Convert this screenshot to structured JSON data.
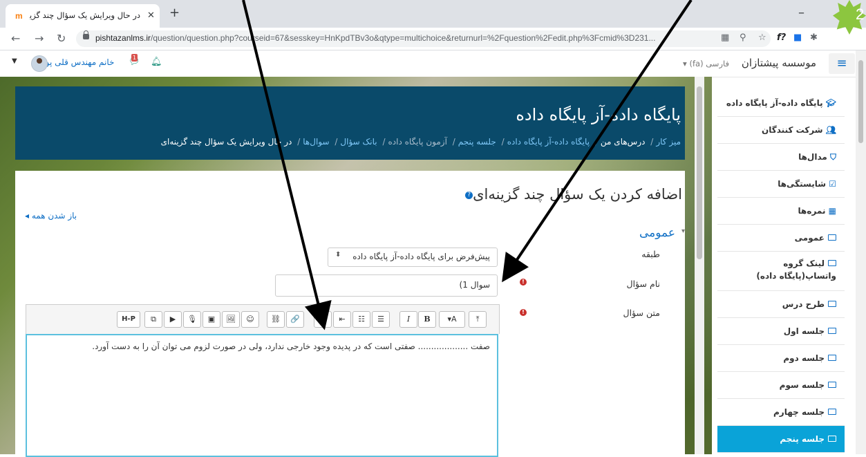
{
  "browser": {
    "tab_title": "در حال ویرایش یک سؤال چند گزینه‌ای",
    "tab_favicon": "m",
    "url_host": "pishtazanlms.ir",
    "url_path": "/question/question.php?courseid=67&sesskey=HnKpdTBv3o&qtype=multichoice&returnurl=%2Fquestion%2Fedit.php%3Fcmid%3D231..."
  },
  "navbar": {
    "brand": "موسسه پیشتازان",
    "language": "فارسی ‎(fa)‎",
    "user_name": "خانم مهندس قلی پور",
    "notification_count": "1"
  },
  "header": {
    "course_title": "پایگاه داده-آز پایگاه داده",
    "breadcrumbs": [
      "میز کار",
      "درس‌های من",
      "پایگاه داده-آز پایگاه داده",
      "جلسه پنجم",
      "آزمون پایگاه داده",
      "بانک سؤال",
      "سوال‌ها",
      "در حال ویرایش یک سؤال چند گزینه‌ای"
    ]
  },
  "form": {
    "heading": "اضافه کردن یک سؤال چند گزینه‌ای",
    "expand_all": "باز شدن همه",
    "section": "عمومی",
    "category_label": "طبقه",
    "category_value": "پیش‌فرض برای پایگاه داده-آز پایگاه داده",
    "name_label": "نام سؤال",
    "name_value": "سوال 1)",
    "text_label": "متن سؤال",
    "text_value": "صفت ................... صفتی است که در پدیده وجود خارجی ندارد، ولی در صورت لزوم می توان آن را به دست آورد."
  },
  "editor_toolbar": [
    "⤒",
    "▾A",
    "B",
    "I",
    "☰",
    "☷",
    "⇤",
    "⇥",
    "🔗",
    "⛓",
    "☺",
    "🖼",
    "▣",
    "🎙",
    "▶",
    "⧉",
    "H-P"
  ],
  "sidebar": {
    "items": [
      {
        "label": "پایگاه داده-آز پایگاه داده",
        "icon": "graduation-cap-icon"
      },
      {
        "label": "شرکت کنندگان",
        "icon": "users-icon"
      },
      {
        "label": "مدال‌ها",
        "icon": "shield-icon"
      },
      {
        "label": "شایستگی‌ها",
        "icon": "check-square-icon"
      },
      {
        "label": "نمره‌ها",
        "icon": "table-icon"
      },
      {
        "label": "عمومی",
        "icon": "folder-icon"
      },
      {
        "label": "لینک گروه واتساپ(پایگاه داده)",
        "icon": "folder-icon"
      },
      {
        "label": "طرح درس",
        "icon": "folder-icon"
      },
      {
        "label": "جلسه اول",
        "icon": "folder-icon"
      },
      {
        "label": "جلسه دوم",
        "icon": "folder-icon"
      },
      {
        "label": "جلسه سوم",
        "icon": "folder-icon"
      },
      {
        "label": "جلسه چهارم",
        "icon": "folder-icon"
      },
      {
        "label": "جلسه پنجم",
        "icon": "folder-icon",
        "active": true
      }
    ]
  },
  "overlay": {
    "step_number": "2"
  },
  "colors": {
    "header_bg": "#0a4a6a",
    "link": "#0f6fc5",
    "active_item": "#0aa3d8",
    "required": "#c9302c"
  }
}
